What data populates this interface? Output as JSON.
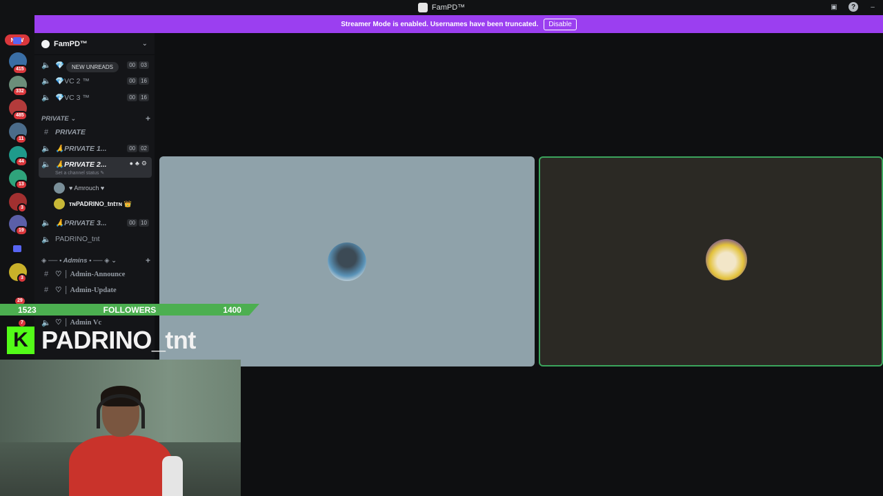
{
  "titlebar": {
    "title": "FamPD™"
  },
  "banner": {
    "message": "Streamer Mode is enabled. Usernames have been truncated.",
    "disable_label": "Disable"
  },
  "guilds": {
    "new_label": "NEW",
    "badges": [
      "415",
      "332",
      "485",
      "11",
      "44",
      "13",
      "3",
      "19",
      "3",
      "29",
      "7"
    ]
  },
  "server": {
    "name": "FamPD™"
  },
  "new_unreads": "NEW UNREADS",
  "channels": {
    "vc1": {
      "label": "💎",
      "c1": "00",
      "c2": "03"
    },
    "vc2": {
      "label": "💎VC 2 ™",
      "c1": "00",
      "c2": "16"
    },
    "vc3": {
      "label": "💎VC 3 ™",
      "c1": "00",
      "c2": "16"
    },
    "cat_private": "PRIVATE ⌄",
    "text_private": "PRIVATE",
    "private1": {
      "label": "🙏PRIVATE 1...",
      "c1": "00",
      "c2": "02"
    },
    "private2": {
      "label": "🙏PRIVATE 2...",
      "status": "Set a channel status ✎"
    },
    "user1": "♥ Amrouch ♥",
    "user2": "ᴛɴPADRINO_tntᴛɴ 👑",
    "private3": {
      "label": "🙏PRIVATE 3...",
      "c1": "00",
      "c2": "10"
    },
    "padrino": "PADRINO_tnt",
    "cat_admins": "◈ ── • Admins • ── ◈ ⌄",
    "admin_announce": "♡ │ Admin-Announce",
    "admin_update": "♡ │ Admin-Update",
    "admin_vc": "♡ │ Admin Vc"
  },
  "overlay": {
    "left_count": "1523",
    "followers_label": "FOLLOWERS",
    "right_count": "1400",
    "name": "PADRINO_tnt",
    "kick_letter": "K"
  },
  "colors": {
    "accent": "#9b3ff0",
    "speaking": "#3ba55d",
    "kick": "#53fc18"
  }
}
